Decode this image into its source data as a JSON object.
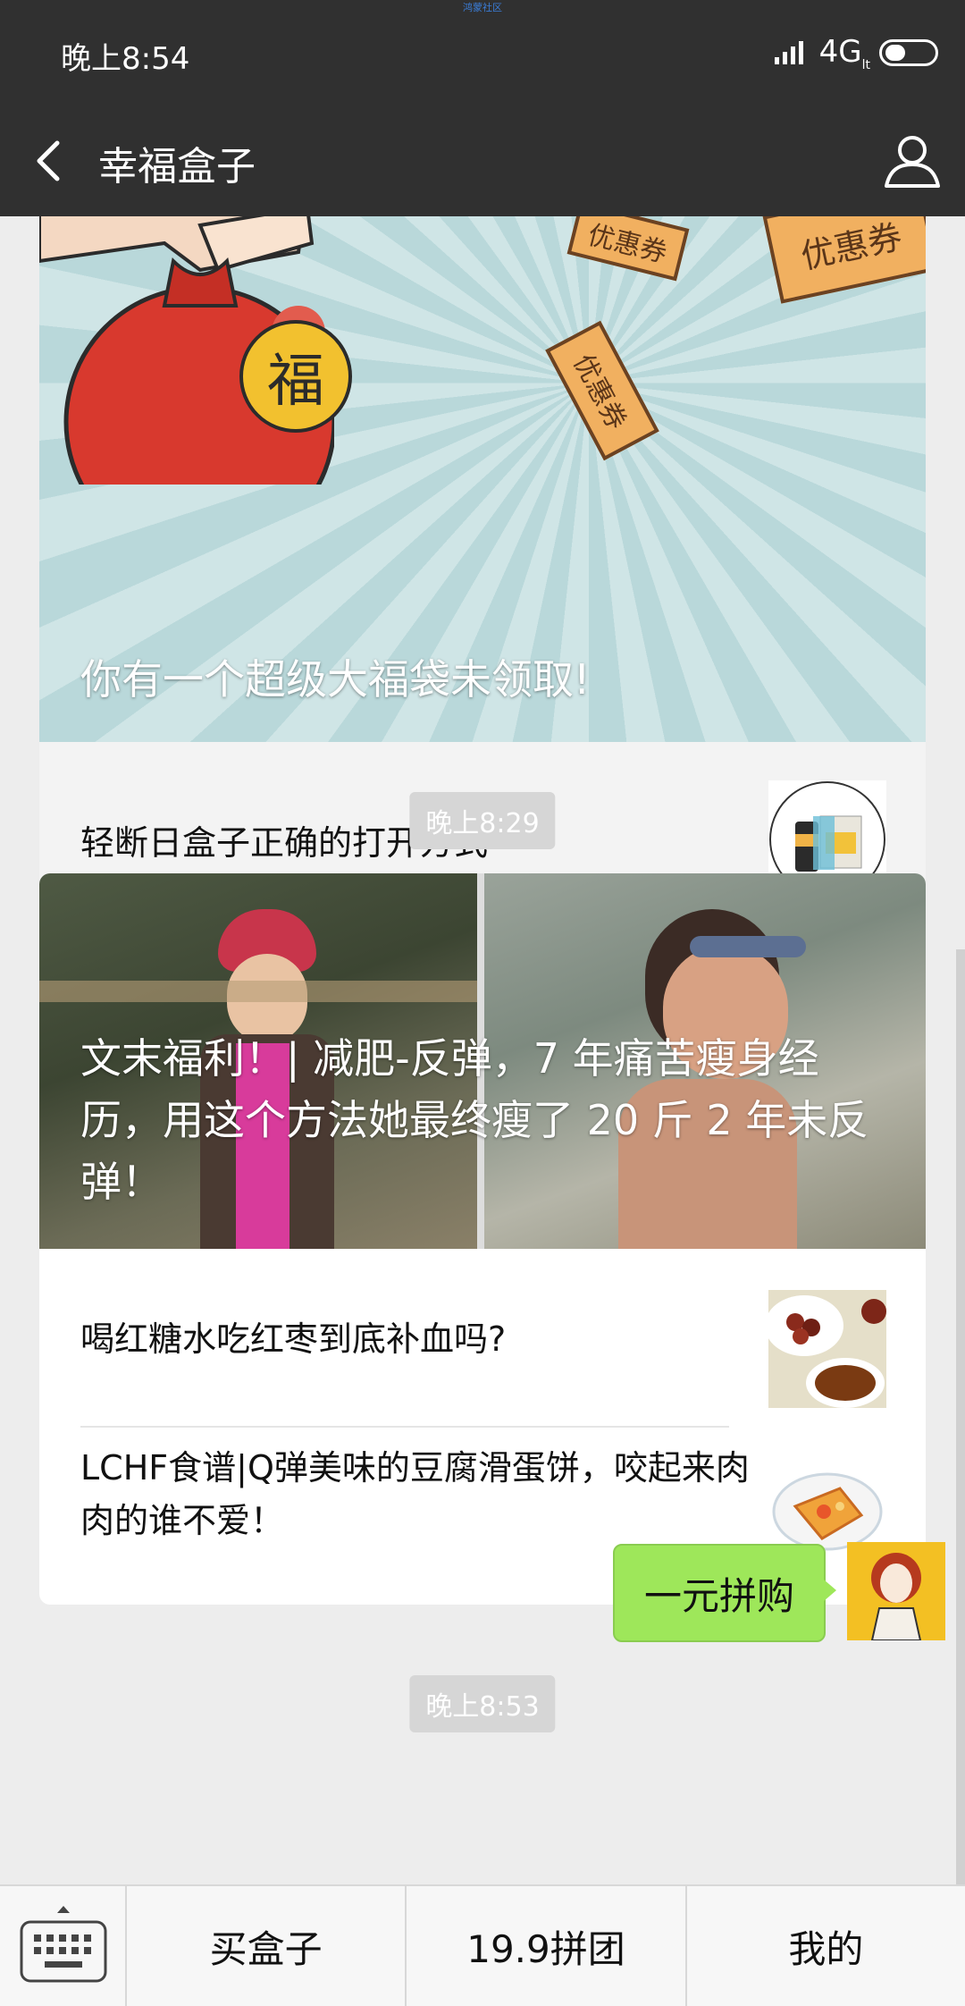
{
  "status_bar": {
    "watermark": "鸿蒙社区",
    "time": "晚上8:54",
    "network": "4G",
    "network_sub": "lt"
  },
  "header": {
    "title": "幸福盒子"
  },
  "messages": {
    "card1": {
      "banner_title": "你有一个超级大福袋未领取!",
      "bag_char": "福",
      "coupon_text": "优惠券",
      "item_title": "轻断日盒子正确的打开方式"
    },
    "time1": "晚上8:29",
    "card2": {
      "banner_title": "文末福利！| 减肥-反弹，7 年痛苦瘦身经历，用这个方法她最终瘦了 20 斤 2 年未反弹！",
      "items": [
        {
          "title": "喝红糖水吃红枣到底补血吗?"
        },
        {
          "title": "LCHF食谱|Q弹美味的豆腐滑蛋饼，咬起来肉肉的谁不爱！"
        }
      ]
    },
    "time2": "晚上8:53",
    "sent_bubble": "一元拼购"
  },
  "bottom_menu": {
    "items": [
      "买盒子",
      "19.9拼团",
      "我的"
    ]
  },
  "colors": {
    "bar": "#303030",
    "bubble": "#9ee75a",
    "background": "#ededed"
  }
}
